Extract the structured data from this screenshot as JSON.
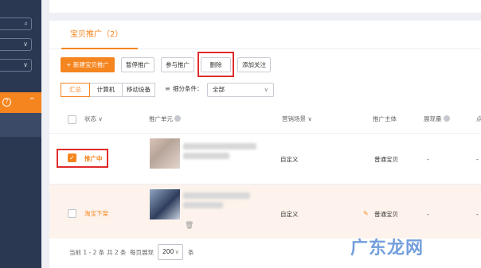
{
  "sidebar": {
    "field_icons": [
      "search-icon",
      "chevron-down-icon",
      "chevron-down-icon"
    ],
    "field_glyphs": [
      "⌕",
      "∨",
      "∨"
    ],
    "menu_glyph": "?",
    "menu_chevron": "^"
  },
  "tab": {
    "label": "宝贝推广（2）"
  },
  "toolbar": {
    "new_label": "+ 新建宝贝推广",
    "pause_label": "暂停推广",
    "join_label": "参与推广",
    "delete_label": "删除",
    "follow_label": "添加关注"
  },
  "segments": [
    "汇总",
    "计算机",
    "移动设备"
  ],
  "filter": {
    "label": "细分条件：",
    "value": "全部",
    "chevron": "∨"
  },
  "table": {
    "headers": {
      "status": "状态 ∨",
      "unit": "推广单元",
      "scene": "营销场景 ∨",
      "subject": "推广主体",
      "impressions": "展现量",
      "clicks": "点"
    },
    "rows": [
      {
        "status": "推广中",
        "scene": "自定义",
        "subject": "普通宝贝",
        "impressions": "-",
        "clicks": "-",
        "checked": true
      },
      {
        "status": "淘宝下架",
        "scene": "自定义",
        "subject": "普通宝贝",
        "impressions": "-",
        "clicks": "-",
        "checked": false
      }
    ]
  },
  "pager": {
    "current": "当前 1 - 2 条",
    "total": "共 2 条",
    "per_page_label": "每页展现",
    "per_page": "200",
    "per_page_chevron": "∨",
    "unit": "条"
  },
  "watermark": "广东龙网",
  "colors": {
    "accent": "#f5851f",
    "highlight": "#e02b2b",
    "sidebar": "#2b3852"
  }
}
